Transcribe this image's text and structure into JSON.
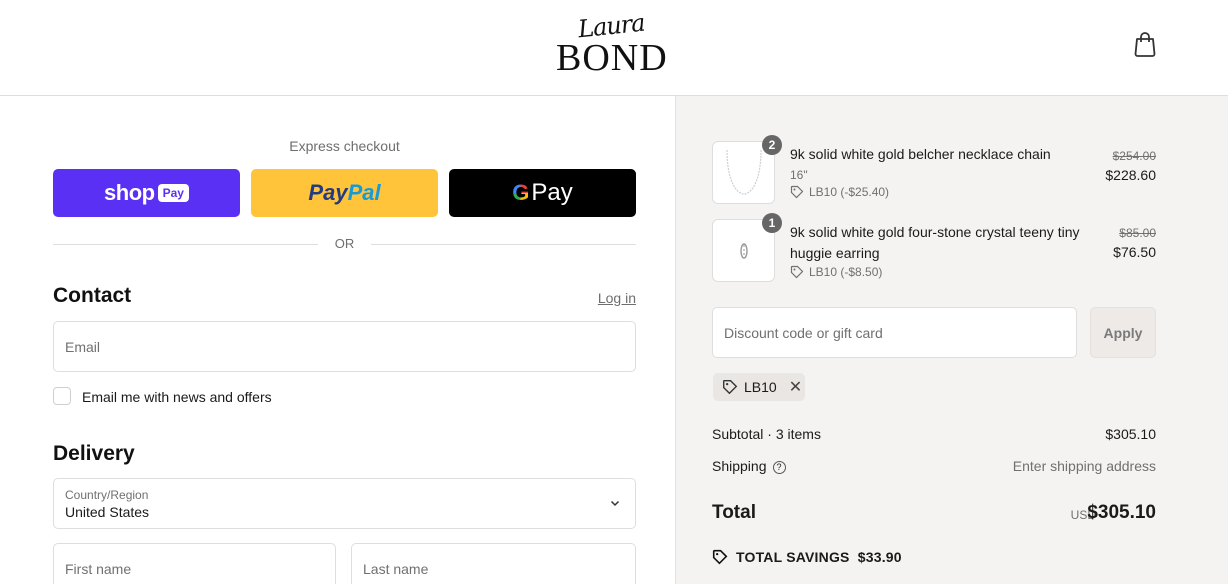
{
  "brand": {
    "logo_script": "Laura",
    "logo_main": "BOND"
  },
  "header": {
    "cart_icon": "shopping-bag-icon"
  },
  "express": {
    "title": "Express checkout",
    "shop_pay": {
      "shop": "shop",
      "pay": "Pay",
      "color": "#5a31f4"
    },
    "paypal": {
      "part1": "Pay",
      "part2": "Pal",
      "color": "#ffc439"
    },
    "gpay": {
      "g": "G",
      "label": "Pay",
      "color": "#000000"
    },
    "or": "OR"
  },
  "contact": {
    "heading": "Contact",
    "login_link": "Log in",
    "email_placeholder": "Email",
    "newsletter_label": "Email me with news and offers"
  },
  "delivery": {
    "heading": "Delivery",
    "country_label": "Country/Region",
    "country_value": "United States",
    "first_name_placeholder": "First name",
    "last_name_placeholder": "Last name"
  },
  "cart": {
    "items": [
      {
        "qty": "2",
        "name": "9k solid white gold belcher necklace chain",
        "variant": "16\"",
        "discount": "LB10 (-$25.40)",
        "price_old": "$254.00",
        "price_new": "$228.60"
      },
      {
        "qty": "1",
        "name": "9k solid white gold four-stone crystal teeny tiny huggie earring",
        "variant": "",
        "discount": "LB10 (-$8.50)",
        "price_old": "$85.00",
        "price_new": "$76.50"
      }
    ],
    "discount_placeholder": "Discount code or gift card",
    "apply_label": "Apply",
    "applied_code": "LB10",
    "subtotal_label": "Subtotal · 3 items",
    "subtotal_value": "$305.10",
    "shipping_label": "Shipping",
    "shipping_value": "Enter shipping address",
    "total_label": "Total",
    "currency": "USD",
    "total_value": "$305.10",
    "savings": "TOTAL SAVINGS  $33.90"
  }
}
